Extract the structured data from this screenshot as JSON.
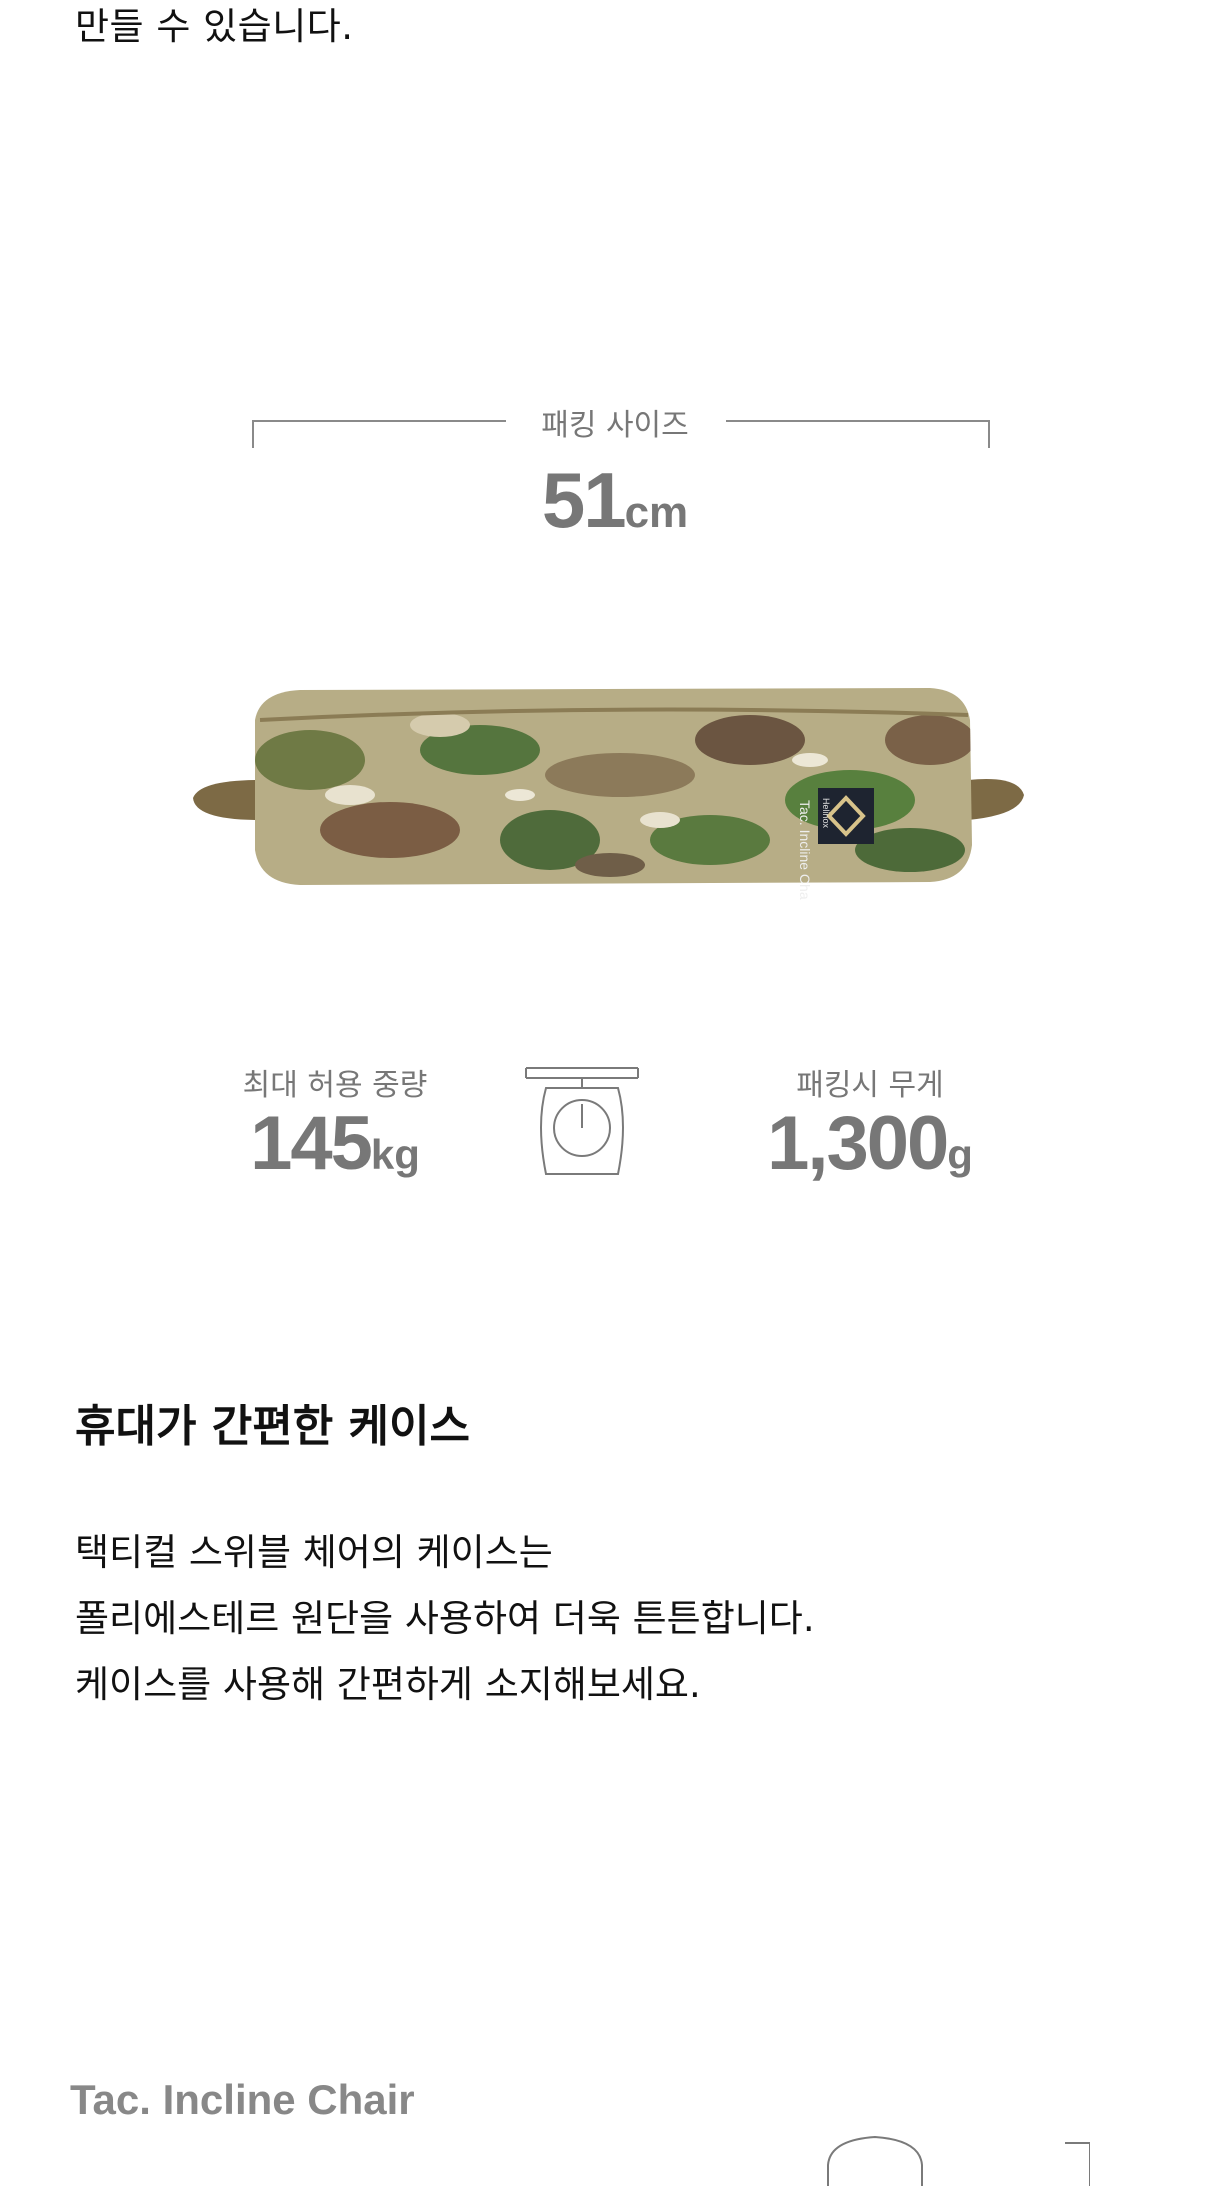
{
  "intro": {
    "tail_line": "만들 수 있습니다."
  },
  "packing_size": {
    "label": "패킹 사이즈",
    "value": "51",
    "unit": "cm"
  },
  "product_image": {
    "alt": "Tac. Incline Chair case",
    "label_text": "Tac. Incline Chair",
    "brand": "Helinox",
    "pattern": "multicam-camouflage"
  },
  "stats": {
    "max_load": {
      "label": "최대 허용 중량",
      "value": "145",
      "unit": "kg"
    },
    "scale_icon": "scale-icon",
    "packed_weight": {
      "label": "패킹시 무게",
      "value": "1,300",
      "unit": "g"
    }
  },
  "section": {
    "heading": "휴대가 간편한 케이스",
    "lines": [
      "택티컬 스위블 체어의 케이스는",
      "폴리에스테르 원단을 사용하여 더욱 튼튼합니다.",
      "케이스를 사용해 간편하게 소지해보세요."
    ]
  },
  "footer": {
    "product_name": "Tac. Incline Chair"
  },
  "colors": {
    "text": "#111111",
    "muted": "#777777",
    "rule": "#8a8a8a",
    "strap": "#7d6a45"
  }
}
